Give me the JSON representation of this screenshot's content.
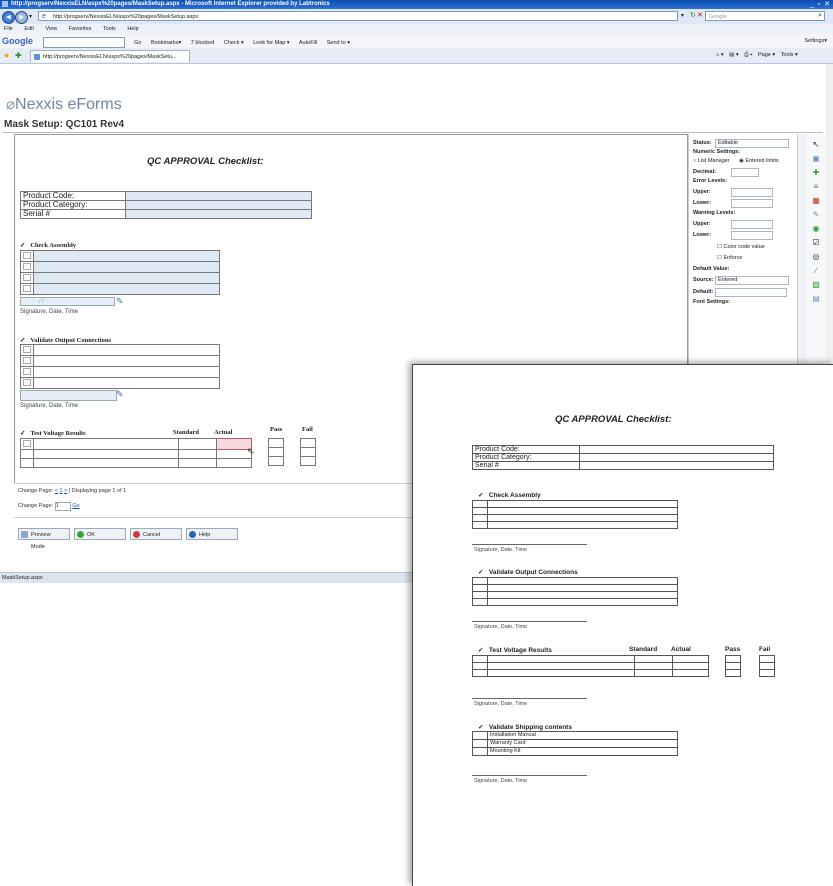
{
  "browser": {
    "title": "http://progserv/NexxisELN/aspx%20pages/MaskSetup.aspx - Microsoft Internet Explorer provided by Labtronics",
    "address": "http://progserv/NexxisELN/aspx%20pages/MaskSetup.aspx",
    "search_placeholder": "Google",
    "menus": [
      "File",
      "Edit",
      "View",
      "Favorites",
      "Tools",
      "Help"
    ],
    "google_bar": [
      "Google",
      "Go",
      "Bookmarks▾",
      "7 blocked",
      "Check ▾",
      "Look for Map ▾",
      "AutoFill",
      "Send to ▾"
    ],
    "settings_label": "Settings▾",
    "tab_label": "http://progserv/NexxisELN/aspx%20pages/MaskSetu...",
    "page_tools": [
      "Page ▾",
      "Tools ▾"
    ],
    "status": "MaskSetup.aspx"
  },
  "app": {
    "logo": "Nexxis eForms",
    "page_title": "Mask Setup: QC101 Rev4"
  },
  "form": {
    "title": "QC APPROVAL Checklist:",
    "fields": [
      "Product Code:",
      "Product Category:",
      "Serial #"
    ],
    "sec_check": "Check Assembly",
    "sec_validate": "Validate Output Connections",
    "sec_voltage": "Test Voltage Results",
    "col_standard": "Standard",
    "col_actual": "Actual",
    "col_pass": "Pass",
    "col_fail": "Fail",
    "sig_label": "Signature, Date, Time",
    "sig_placeholder": "/ /",
    "pager": {
      "change_page_prefix": "Change Page:",
      "prev": "<",
      "page": "1",
      "next": ">",
      "displaying": "| Displaying page 1 of 1",
      "input_value": "1",
      "go": "Go"
    },
    "buttons": {
      "preview": "Preview Mode",
      "ok": "OK",
      "cancel": "Cancel",
      "help": "Help"
    }
  },
  "properties": {
    "status_label": "Status:",
    "status_value": "Editable",
    "numeric_label": "Numeric Settings:",
    "radio_list": "List Manager",
    "radio_entered": "Entered limits",
    "decimal_label": "Decimal:",
    "error_label": "Error Levels:",
    "upper_label": "Upper:",
    "lower_label": "Lower:",
    "warning_label": "Warning Levels:",
    "color_code": "Color code value",
    "enforce": "Enforce",
    "default_value_label": "Default Value:",
    "source_label": "Source:",
    "source_value": "Entered",
    "default_label": "Default:",
    "font_label": "Font Settings:"
  },
  "paper": {
    "title": "QC APPROVAL  Checklist:",
    "fields": [
      "Product Code:",
      "Product Category:",
      "Serial #"
    ],
    "sec_check": "Check Assembly",
    "sec_validate": "Validate Output Connections",
    "sec_voltage": "Test Voltage Results",
    "col_standard": "Standard",
    "col_actual": "Actual",
    "col_pass": "Pass",
    "col_fail": "Fail",
    "sec_shipping": "Validate  Shipping  contents",
    "shipping_items": [
      "Installation Manual",
      "Warranty Card",
      "Mounting Kit"
    ],
    "sig_label": "Signature, Date, Time"
  }
}
